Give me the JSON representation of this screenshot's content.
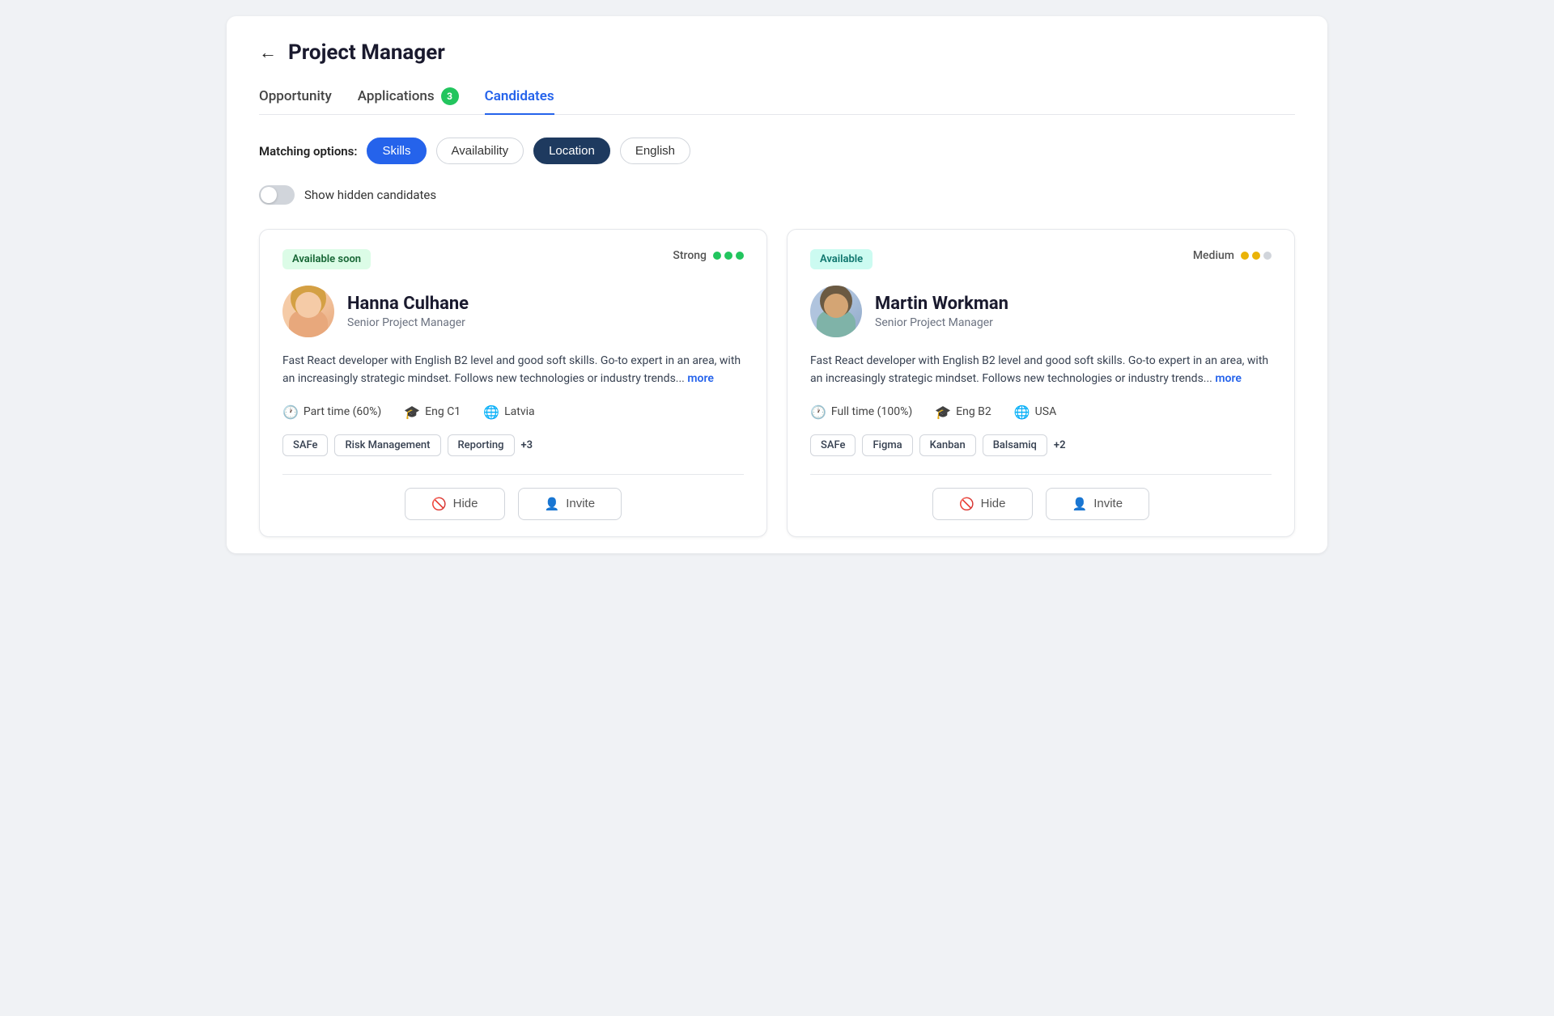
{
  "header": {
    "back_label": "←",
    "title": "Project Manager"
  },
  "tabs": [
    {
      "id": "opportunity",
      "label": "Opportunity",
      "active": false,
      "badge": null
    },
    {
      "id": "applications",
      "label": "Applications",
      "active": false,
      "badge": "3"
    },
    {
      "id": "candidates",
      "label": "Candidates",
      "active": true,
      "badge": null
    }
  ],
  "matching": {
    "label": "Matching options:",
    "filters": [
      {
        "id": "skills",
        "label": "Skills",
        "state": "active-blue"
      },
      {
        "id": "availability",
        "label": "Availability",
        "state": "default"
      },
      {
        "id": "location",
        "label": "Location",
        "state": "active-dark"
      },
      {
        "id": "english",
        "label": "English",
        "state": "default"
      }
    ]
  },
  "show_hidden": {
    "label": "Show hidden candidates",
    "enabled": false
  },
  "candidates": [
    {
      "id": "hanna",
      "availability": "Available soon",
      "availability_type": "soon",
      "match_label": "Strong",
      "match_dots": [
        "green",
        "green",
        "green"
      ],
      "name": "Hanna Culhane",
      "title": "Senior Project Manager",
      "bio": "Fast React developer with English B2 level and good soft skills. Go-to expert in an area, with an increasingly strategic mindset. Follows new technologies or industry trends...",
      "bio_more": "more",
      "time_commitment": "Part time (60%)",
      "english_level": "Eng C1",
      "location": "Latvia",
      "skills": [
        "SAFe",
        "Risk Management",
        "Reporting"
      ],
      "skills_more": "+3",
      "hide_label": "Hide",
      "invite_label": "Invite"
    },
    {
      "id": "martin",
      "availability": "Available",
      "availability_type": "available",
      "match_label": "Medium",
      "match_dots": [
        "yellow",
        "yellow",
        "gray"
      ],
      "name": "Martin Workman",
      "title": "Senior Project Manager",
      "bio": "Fast React developer with English B2 level and good soft skills. Go-to expert in an area, with an increasingly strategic mindset. Follows new technologies or industry trends...",
      "bio_more": "more",
      "time_commitment": "Full time (100%)",
      "english_level": "Eng B2",
      "location": "USA",
      "skills": [
        "SAFe",
        "Figma",
        "Kanban",
        "Balsamiq"
      ],
      "skills_more": "+2",
      "hide_label": "Hide",
      "invite_label": "Invite"
    }
  ]
}
